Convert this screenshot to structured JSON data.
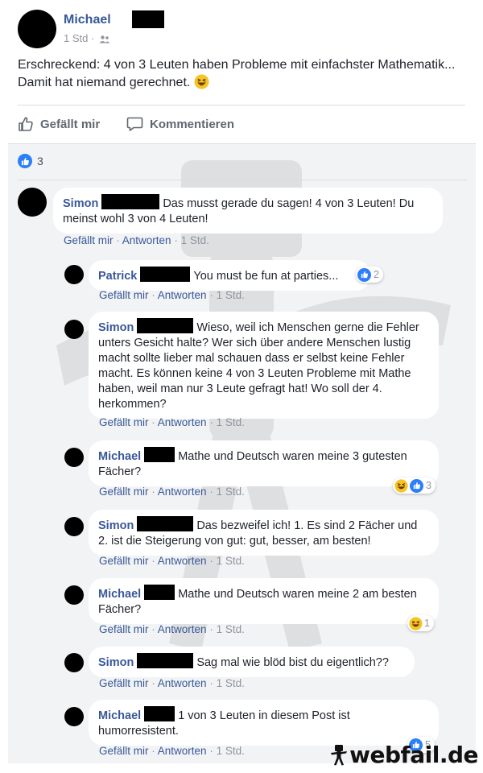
{
  "post": {
    "author": "Michael",
    "time": "1 Std",
    "separator": "·",
    "text": "Erschreckend: 4 von 3 Leuten haben Probleme mit einfachster Mathematik... Damit hat niemand gerechnet.",
    "emoji_icon": "laughing-emoji-icon"
  },
  "actions": {
    "like": "Gefällt mir",
    "comment": "Kommentieren"
  },
  "summary": {
    "like_count": "3"
  },
  "comment_actions": {
    "like": "Gefällt mir",
    "reply": "Antworten",
    "sep": " · ",
    "time": "1 Std."
  },
  "comments": [
    {
      "author": "Simon",
      "text": "Das musst gerade du sagen! 4 von 3 Leuten! Du meinst wohl 3 von 4 Leuten!",
      "reactions": ""
    },
    {
      "author": "Patrick",
      "text": "You must be fun at parties...",
      "reactions": "2"
    },
    {
      "author": "Simon",
      "text": "Wieso, weil ich Menschen gerne die Fehler unters Gesicht halte? Wer sich über andere Menschen lustig macht sollte lieber mal schauen dass er selbst keine Fehler macht. Es können keine 4 von 3 Leuten Probleme mit Mathe haben, weil man nur 3 Leute gefragt hat! Wo soll der 4. herkommen?",
      "reactions": ""
    },
    {
      "author": "Michael",
      "text": "Mathe und Deutsch waren meine 3 gutesten Fächer?",
      "reactions": "3"
    },
    {
      "author": "Simon",
      "text": "Das bezweifel ich! 1. Es sind 2 Fächer und 2. ist die Steigerung von gut: gut, besser, am besten!",
      "reactions": ""
    },
    {
      "author": "Michael",
      "text": "Mathe und Deutsch waren meine 2 am besten Fächer?",
      "reactions": "1"
    },
    {
      "author": "Simon",
      "text": "Sag mal wie blöd bist du eigentlich??",
      "reactions": ""
    },
    {
      "author": "Michael",
      "text": "1 von 3 Leuten in diesem Post ist humorresistent.",
      "reactions": "5"
    }
  ],
  "watermark": {
    "brand": "webfail.de"
  },
  "colors": {
    "link": "#385898",
    "like_blue": "#2d7ff9",
    "panel_bg": "#f2f3f5",
    "muted": "#90949c"
  }
}
